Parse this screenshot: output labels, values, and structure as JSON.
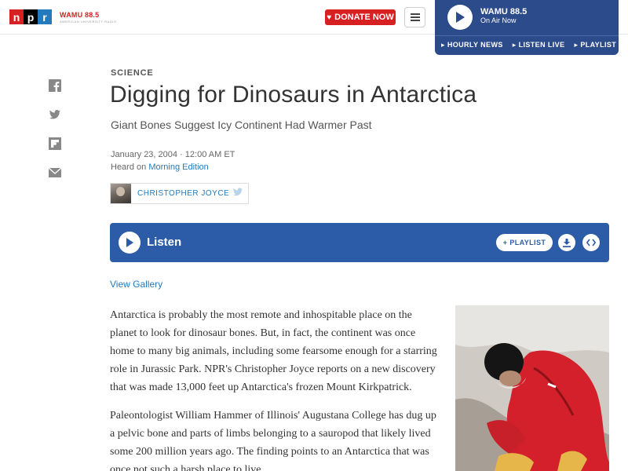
{
  "header": {
    "station_logo": "WAMU 88.5",
    "station_tagline": "AMERICAN UNIVERSITY RADIO",
    "donate_label": "DONATE NOW"
  },
  "player": {
    "station": "WAMU 88.5",
    "status": "On Air Now",
    "links": [
      "HOURLY NEWS",
      "LISTEN LIVE",
      "PLAYLIST"
    ]
  },
  "share_icons": [
    "facebook-icon",
    "twitter-icon",
    "flipboard-icon",
    "email-icon"
  ],
  "article": {
    "section": "SCIENCE",
    "title": "Digging for Dinosaurs in Antarctica",
    "subtitle": "Giant Bones Suggest Icy Continent Had Warmer Past",
    "date": "January 23, 2004 · 12:00 AM ET",
    "heard_prefix": "Heard on",
    "heard_program": "Morning Edition",
    "author": "CHRISTOPHER JOYCE",
    "listen_label": "Listen",
    "playlist_label": "PLAYLIST",
    "view_gallery": "View Gallery",
    "paragraphs": [
      "Antarctica is probably the most remote and inhospitable place on the planet to look for dinosaur bones. But, in fact, the continent was once home to many big animals, including some fearsome enough for a starring role in Jurassic Park. NPR's Christopher Joyce reports on a new discovery that was made 13,000 feet up Antarctica's frozen Mount Kirkpatrick.",
      "Paleontologist William Hammer of Illinois' Augustana College has dug up a pelvic bone and parts of limbs belonging to a sauropod that likely lived some 200 million years ago. The finding points to an Antarctica that was once not such a harsh place to live."
    ]
  },
  "colors": {
    "npr_red": "#d62021",
    "npr_blue": "#237bbd",
    "player_bg": "#2c4b8a",
    "listen_bg": "#2c5ca8"
  }
}
